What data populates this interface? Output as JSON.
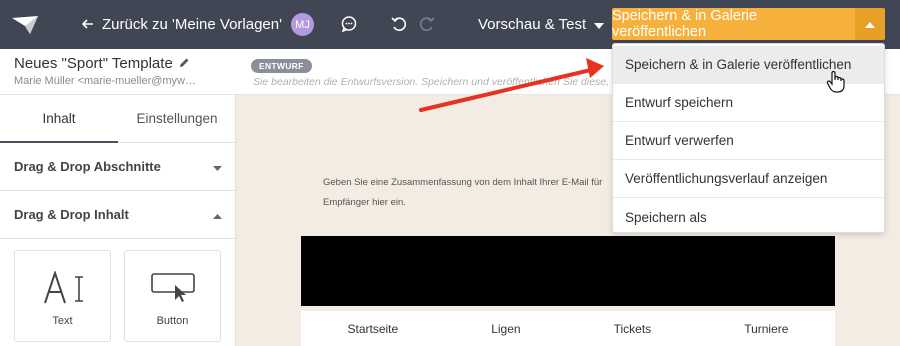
{
  "topbar": {
    "back_label": "Zurück zu 'Meine Vorlagen'",
    "avatar_initials": "MJ",
    "preview_label": "Vorschau & Test",
    "save_label": "Speichern & in Galerie veröffentlichen",
    "accent_color": "#f5b13c"
  },
  "template": {
    "name": "Neues \"Sport\" Template",
    "author": "Marie Müller <marie-mueller@mywe…",
    "badge": "ENTWURF",
    "draft_message": "Sie bearbeiten die Entwurfsversion. Speichern und veröffentlichen Sie diese, …"
  },
  "sidebar": {
    "tabs": [
      {
        "label": "Inhalt"
      },
      {
        "label": "Einstellungen"
      }
    ],
    "sections": [
      {
        "label": "Drag & Drop Abschnitte"
      },
      {
        "label": "Drag & Drop Inhalt"
      }
    ],
    "blocks": [
      {
        "label": "Text",
        "icon": "text-icon"
      },
      {
        "label": "Button",
        "icon": "button-icon"
      }
    ]
  },
  "canvas": {
    "preheader_line1": "Geben Sie eine Zusammenfassung von dem Inhalt Ihrer E-Mail für",
    "preheader_line2": "Empfänger hier ein.",
    "nav": [
      "Startseite",
      "Ligen",
      "Tickets",
      "Turniere"
    ]
  },
  "dropdown": {
    "items": [
      {
        "label": "Speichern & in Galerie veröffentlichen"
      },
      {
        "label": "Entwurf speichern"
      },
      {
        "label": "Entwurf verwerfen"
      },
      {
        "label": "Veröffentlichungsverlauf anzeigen"
      },
      {
        "label": "Speichern als"
      }
    ]
  }
}
